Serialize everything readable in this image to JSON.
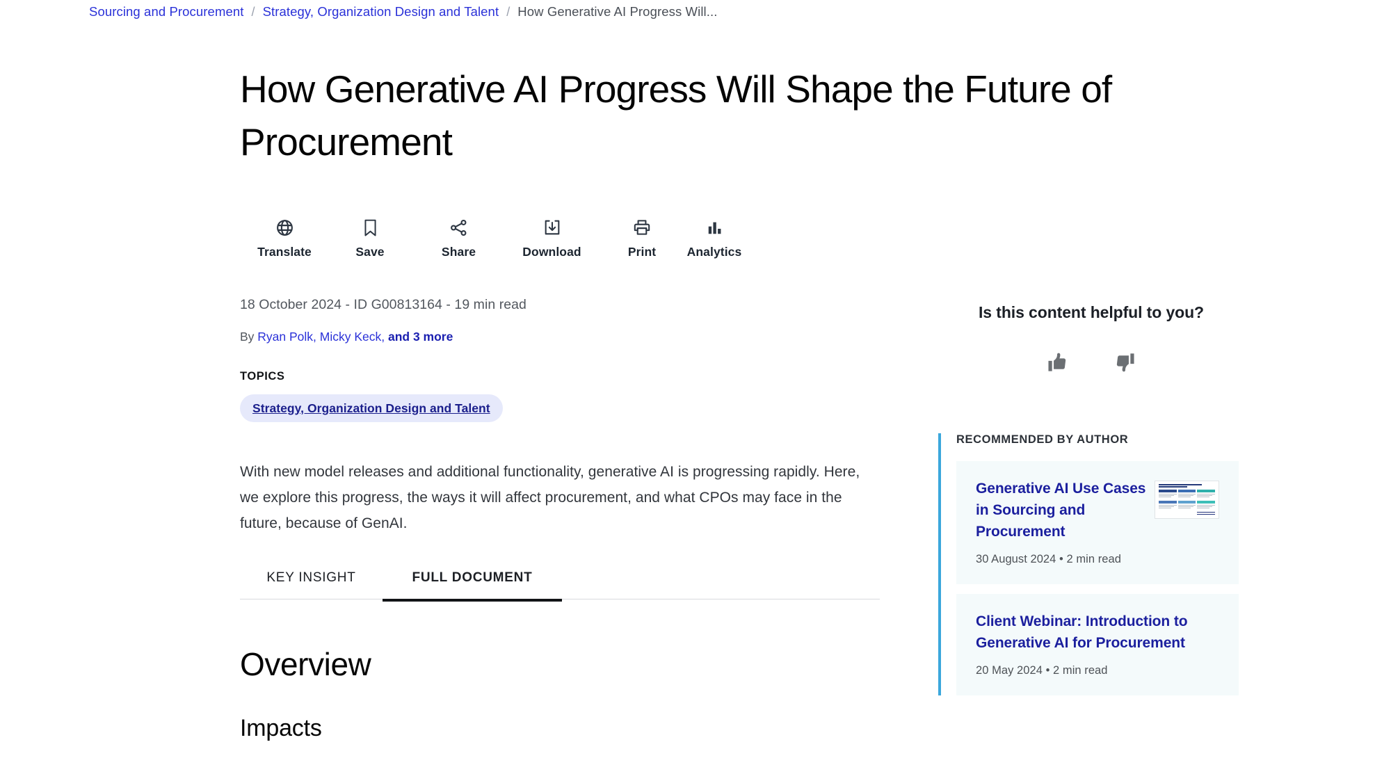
{
  "breadcrumb": {
    "items": [
      {
        "label": "Sourcing and Procurement",
        "type": "link"
      },
      {
        "label": "Strategy, Organization Design and Talent",
        "type": "link"
      },
      {
        "label": "How Generative AI Progress Will...",
        "type": "current"
      }
    ],
    "separator": "/"
  },
  "document": {
    "title": "How Generative AI Progress Will Shape the Future of Procurement",
    "meta": "18 October 2024 - ID G00813164 - 19 min read",
    "byline_prefix": "By ",
    "authors": "Ryan Polk, Micky Keck,",
    "authors_more": " and 3 more",
    "topics_label": "TOPICS",
    "topic_chip": "Strategy, Organization Design and Talent",
    "abstract": "With new model releases and additional functionality, generative AI is progressing rapidly. Here, we explore this progress, the ways it will affect procurement, and what CPOs may face in the future, because of GenAI.",
    "section_overview": "Overview",
    "section_impacts": "Impacts"
  },
  "toolbar": {
    "actions": [
      {
        "label": "Translate",
        "icon": "globe-icon"
      },
      {
        "label": "Save",
        "icon": "bookmark-icon"
      },
      {
        "label": "Share",
        "icon": "share-icon"
      },
      {
        "label": "Download",
        "icon": "download-icon"
      },
      {
        "label": "Print",
        "icon": "print-icon"
      },
      {
        "label": "Analytics",
        "icon": "analytics-icon"
      }
    ]
  },
  "tabs": [
    {
      "label": "KEY INSIGHT",
      "active": false
    },
    {
      "label": "FULL DOCUMENT",
      "active": true
    }
  ],
  "sidebar": {
    "helpful_question": "Is this content helpful to you?",
    "thumbs_up_icon": "thumbs-up-icon",
    "thumbs_down_icon": "thumbs-down-icon",
    "recommended_label": "RECOMMENDED BY AUTHOR",
    "accent_color": "#3BA7DC",
    "card_background": "#F4FAFB",
    "link_color": "#1b1f9e",
    "cards": [
      {
        "title": "Generative AI Use Cases in Sourcing and Procurement",
        "meta": "30 August 2024 • 2 min read",
        "thumbnail": "table-graphic-thumbnail"
      },
      {
        "title": "Client Webinar: Introduction to Generative AI for Procurement",
        "meta": "20 May 2024 • 2 min read"
      }
    ]
  },
  "colors": {
    "link_blue": "#2A31D8",
    "chip_background": "#E6E9FB",
    "chip_text": "#1b1f8c",
    "icon_dark": "#2D3642"
  }
}
